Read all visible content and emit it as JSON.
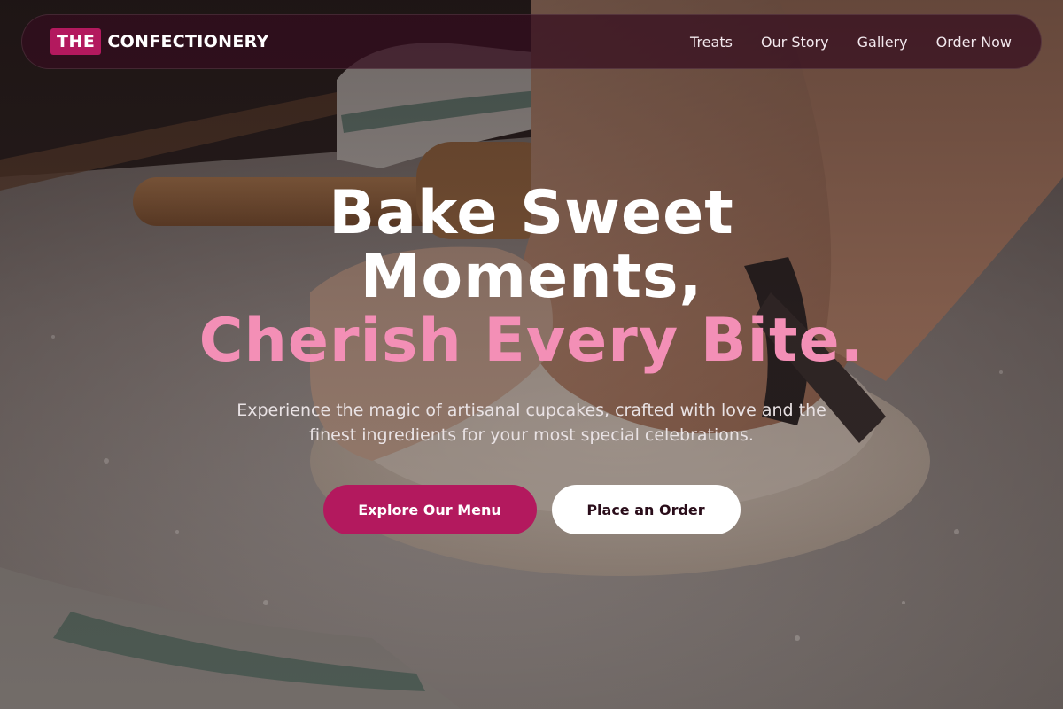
{
  "brand": {
    "prefix": "THE",
    "name": "CONFECTIONERY"
  },
  "nav": {
    "links": [
      {
        "label": "Treats"
      },
      {
        "label": "Our Story"
      },
      {
        "label": "Gallery"
      },
      {
        "label": "Order Now"
      }
    ]
  },
  "hero": {
    "headline_line1": "Bake Sweet",
    "headline_line2": "Moments,",
    "headline_accent": "Cherish Every Bite.",
    "subtext": "Experience the magic of artisanal cupcakes, crafted with love and the finest ingredients for your most special celebrations.",
    "primary_cta": "Explore Our Menu",
    "secondary_cta": "Place an Order"
  },
  "colors": {
    "accent": "#b3195e",
    "accent_text": "#f38fb6",
    "nav_bg": "#340c1e"
  }
}
